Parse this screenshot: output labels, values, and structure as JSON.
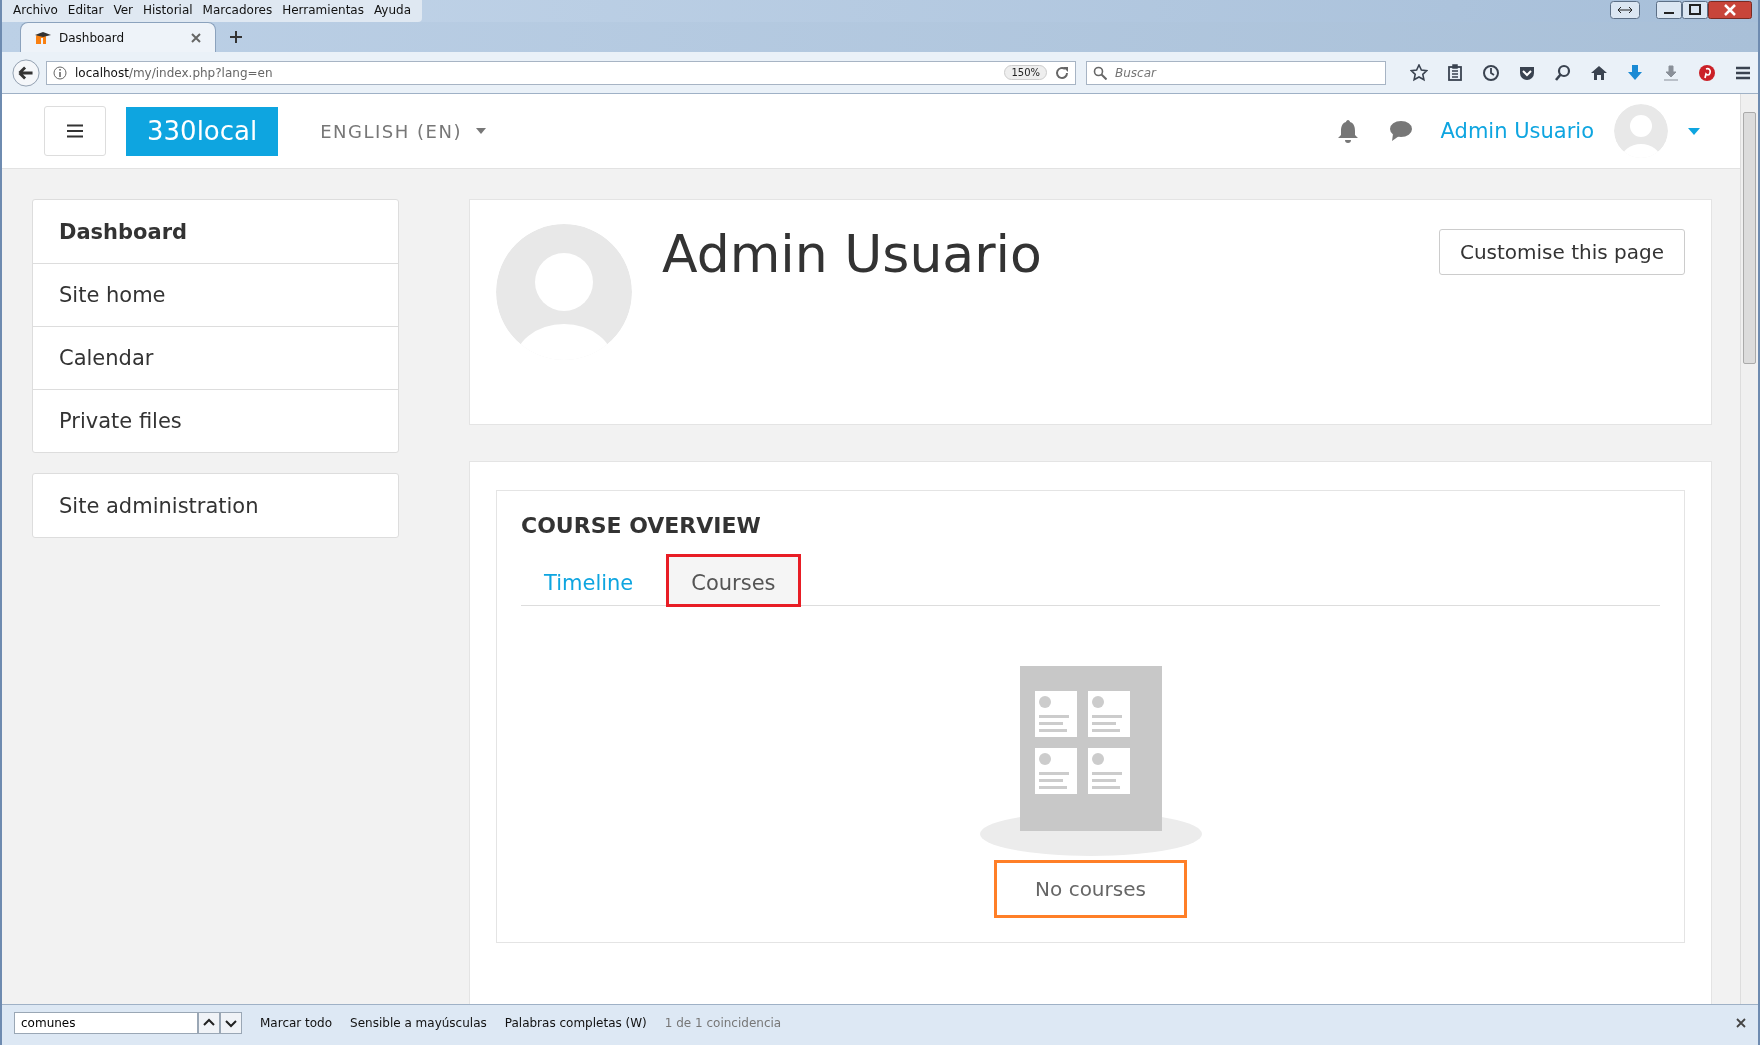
{
  "browser": {
    "menu": [
      "Archivo",
      "Editar",
      "Ver",
      "Historial",
      "Marcadores",
      "Herramientas",
      "Ayuda"
    ],
    "tab": {
      "title": "Dashboard"
    },
    "url": {
      "host": "localhost",
      "path": "/my/index.php?lang=en",
      "zoom": "150%"
    },
    "search": {
      "placeholder": "Buscar"
    }
  },
  "navbar": {
    "brand": "330local",
    "language": "ENGLISH (EN)",
    "user_name": "Admin Usuario"
  },
  "sidebar": {
    "groups": [
      {
        "items": [
          {
            "label": "Dashboard",
            "selected": true
          },
          {
            "label": "Site home",
            "selected": false
          },
          {
            "label": "Calendar",
            "selected": false
          },
          {
            "label": "Private files",
            "selected": false
          }
        ]
      },
      {
        "items": [
          {
            "label": "Site administration",
            "selected": false
          }
        ]
      }
    ]
  },
  "header": {
    "name": "Admin Usuario",
    "button": "Customise this page"
  },
  "course_overview": {
    "title": "COURSE OVERVIEW",
    "tabs": [
      {
        "label": "Timeline",
        "selected": false,
        "highlighted": false
      },
      {
        "label": "Courses",
        "selected": true,
        "highlighted": true
      }
    ],
    "empty_message": {
      "text": "No courses",
      "highlighted": true
    }
  },
  "find_bar": {
    "query": "comunes",
    "options": [
      "Marcar todo",
      "Sensible a mayúsculas",
      "Palabras completas (W)"
    ],
    "result": "1 de 1 coincidencia"
  }
}
